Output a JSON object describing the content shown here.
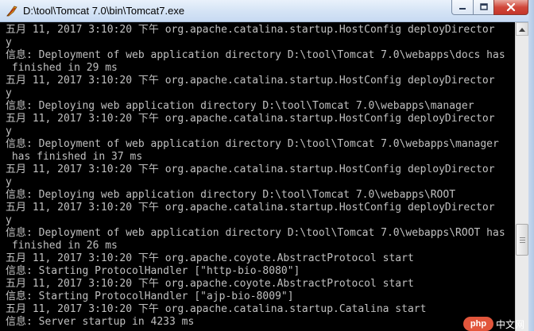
{
  "window": {
    "title": "D:\\tool\\Tomcat 7.0\\bin\\Tomcat7.exe"
  },
  "title_bar": {
    "icon": "tomcat-feather-icon",
    "buttons": [
      {
        "name": "minimize",
        "icon": "minimize-icon"
      },
      {
        "name": "maximize",
        "icon": "maximize-icon"
      },
      {
        "name": "close",
        "icon": "close-icon"
      }
    ]
  },
  "console": {
    "lines": [
      "五月 11, 2017 3:10:20 下午 org.apache.catalina.startup.HostConfig deployDirector",
      "y",
      "信息: Deployment of web application directory D:\\tool\\Tomcat 7.0\\webapps\\docs has",
      " finished in 29 ms",
      "五月 11, 2017 3:10:20 下午 org.apache.catalina.startup.HostConfig deployDirector",
      "y",
      "信息: Deploying web application directory D:\\tool\\Tomcat 7.0\\webapps\\manager",
      "五月 11, 2017 3:10:20 下午 org.apache.catalina.startup.HostConfig deployDirector",
      "y",
      "信息: Deployment of web application directory D:\\tool\\Tomcat 7.0\\webapps\\manager",
      " has finished in 37 ms",
      "五月 11, 2017 3:10:20 下午 org.apache.catalina.startup.HostConfig deployDirector",
      "y",
      "信息: Deploying web application directory D:\\tool\\Tomcat 7.0\\webapps\\ROOT",
      "五月 11, 2017 3:10:20 下午 org.apache.catalina.startup.HostConfig deployDirector",
      "y",
      "信息: Deployment of web application directory D:\\tool\\Tomcat 7.0\\webapps\\ROOT has",
      " finished in 26 ms",
      "五月 11, 2017 3:10:20 下午 org.apache.coyote.AbstractProtocol start",
      "信息: Starting ProtocolHandler [\"http-bio-8080\"]",
      "五月 11, 2017 3:10:20 下午 org.apache.coyote.AbstractProtocol start",
      "信息: Starting ProtocolHandler [\"ajp-bio-8009\"]",
      "五月 11, 2017 3:10:20 下午 org.apache.catalina.startup.Catalina start",
      "信息: Server startup in 4233 ms"
    ]
  },
  "scrollbar": {
    "position_fraction": 0.95
  },
  "watermark": {
    "badge": "php",
    "text": "中文网"
  }
}
